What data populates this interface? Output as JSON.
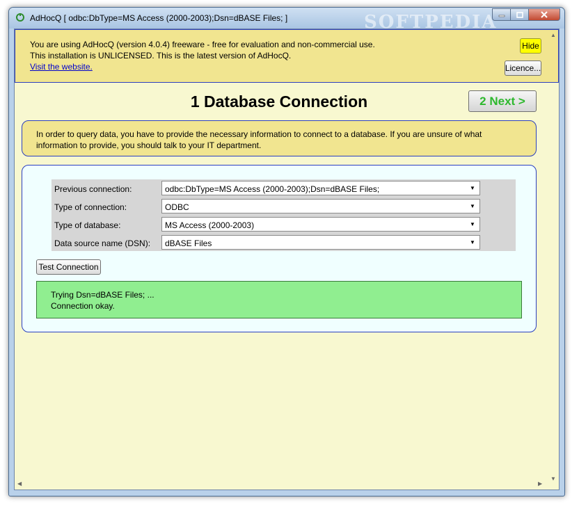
{
  "window": {
    "title": "AdHocQ [ odbc:DbType=MS Access (2000-2003);Dsn=dBASE Files; ]",
    "watermark": "SOFTPEDIA"
  },
  "banner": {
    "line1": "You are using AdHocQ (version 4.0.4) freeware - free for evaluation and non-commercial use.",
    "line2": "This installation is UNLICENSED. This is the latest version of AdHocQ.",
    "link": "Visit the website.",
    "hide_label": "Hide",
    "licence_label": "Licence..."
  },
  "header": {
    "title": "1 Database Connection",
    "next_label": "2 Next >"
  },
  "info": {
    "text": "In order to query data, you have to provide the necessary information to connect to a database. If you are unsure of what information to provide, you should talk to your IT department."
  },
  "form": {
    "rows": [
      {
        "label": "Previous connection:",
        "value": "odbc:DbType=MS Access (2000-2003);Dsn=dBASE Files;"
      },
      {
        "label": "Type of connection:",
        "value": "ODBC"
      },
      {
        "label": "Type of database:",
        "value": "MS Access (2000-2003)"
      },
      {
        "label": "Data source name (DSN):",
        "value": "dBASE Files"
      }
    ],
    "test_label": "Test Connection"
  },
  "result": {
    "line1": "Trying Dsn=dBASE Files;  ...",
    "line2": "Connection okay."
  },
  "colors": {
    "banner_bg": "#f1e590",
    "client_bg": "#f8f8d0",
    "panel_bg": "#f0ffff",
    "success_bg": "#90ee90",
    "next_text": "#2eb82e",
    "hide_bg": "#ffff00"
  }
}
